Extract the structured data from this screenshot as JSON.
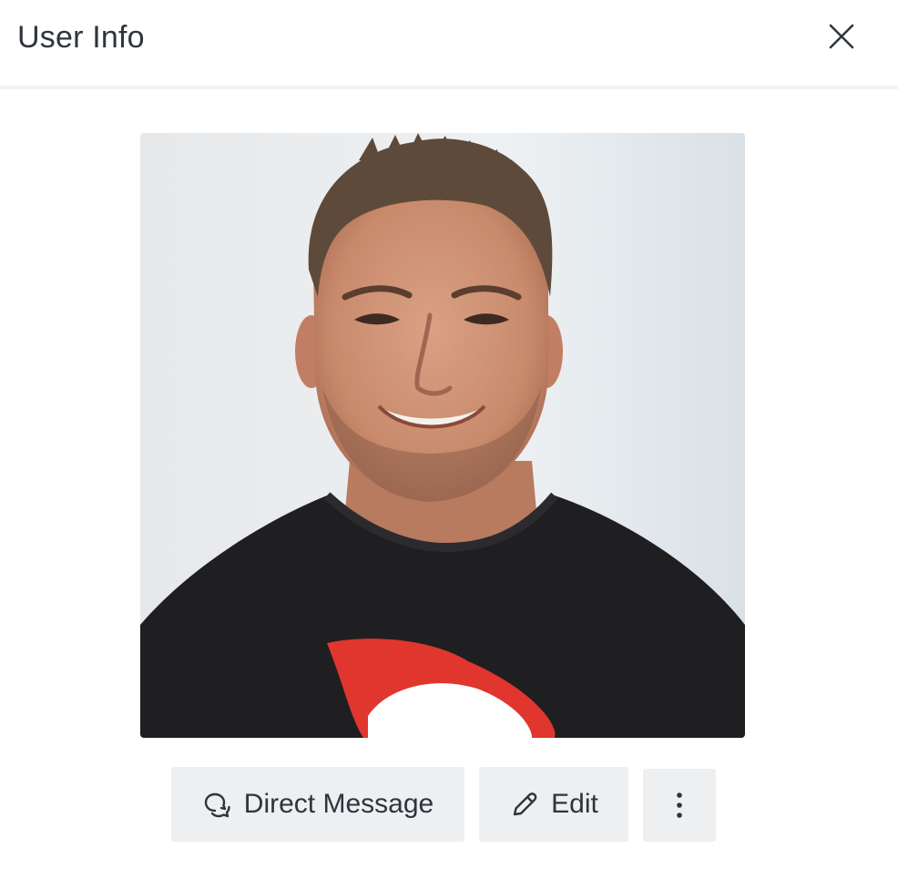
{
  "header": {
    "title": "User Info"
  },
  "icons": {
    "close": "close-icon",
    "direct_message": "chat-bubble-icon",
    "edit": "pencil-icon",
    "more": "kebab-menu-icon"
  },
  "avatar": {
    "description_name": "user-avatar"
  },
  "actions": {
    "direct_message_label": "Direct Message",
    "edit_label": "Edit"
  },
  "colors": {
    "text": "#2f343d",
    "button_bg": "#eeeff1",
    "divider": "#f2f3f5",
    "tshirt_logo": "#e0362e"
  }
}
